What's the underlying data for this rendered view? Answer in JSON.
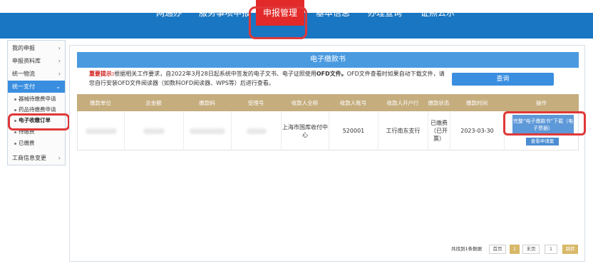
{
  "nav": {
    "items": [
      "一网通办",
      "服务事项申报",
      "申报管理",
      "基本信息",
      "办理查询",
      "证照公示"
    ]
  },
  "sidebar": {
    "items": [
      "我的申报",
      "申报资料库",
      "统一物流",
      "统一支付"
    ],
    "sub_items": [
      "器械待缴费申请",
      "药品待缴费申请",
      "电子收缴订单",
      "待缴费",
      "已缴费"
    ],
    "footer_item": "工商信息变更"
  },
  "panel": {
    "title": "电子缴款书",
    "notice_label": "重要提示:",
    "notice_text_1": "根据相关工作要求，自2022年3月28日起系统中签发的电子文书、电子证照使用",
    "notice_bold": "OFD文件。",
    "notice_text_2": "OFD文件查看时如果自动下载文件，请您自行安装OFD文件阅读器（如数科OFD阅读器、WPS等）后进行查看。",
    "query_button": "查询"
  },
  "table": {
    "headers": [
      "缴款单位",
      "总金额",
      "缴款码",
      "受理号",
      "收款人全称",
      "收款人账号",
      "收款人开户行",
      "缴款状态",
      "缴款时间",
      "操作"
    ],
    "row": {
      "payee_name": "上海市国库收付中心",
      "payee_account": "520001",
      "payee_bank": "工行南东支行",
      "status": "已缴费（已开票）",
      "pay_time": "2023-03-30",
      "download_button": "完整“电子缴款书”下载（电子票据）",
      "view_button": "查看申请案"
    }
  },
  "pager": {
    "summary": "共找到1条数据",
    "first": "首页",
    "current": "1",
    "last": "末页",
    "jump_value": "1",
    "go": "跳转"
  }
}
